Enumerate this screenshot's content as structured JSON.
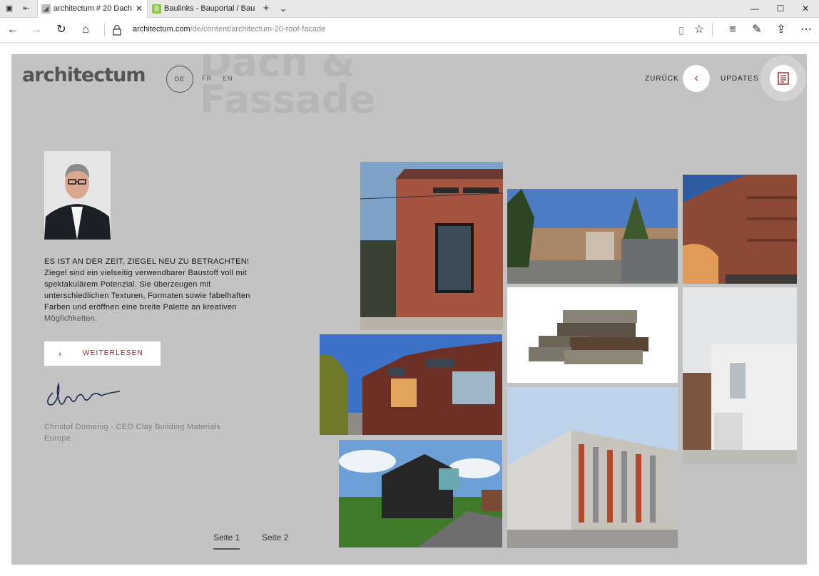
{
  "browser": {
    "tabs": [
      {
        "title": "architectum # 20 Dach",
        "active": true
      },
      {
        "title": "Baulinks - Bauportal / Baurr",
        "active": false
      }
    ],
    "url_host": "architectum.com",
    "url_path": "/de/content/architectum-20-roof-facade",
    "new_tab_label": "+",
    "tab_menu_label": "⌄"
  },
  "header": {
    "logo": "architectum",
    "ghost_title": "Dach &\nFassade",
    "languages": [
      "DE",
      "FR",
      "EN"
    ],
    "back_label": "ZURÜCK",
    "updates_label": "UPDATES"
  },
  "intro": {
    "text": "ES IST AN DER ZEIT, ZIEGEL NEU ZU BETRACHTEN! Ziegel sind ein vielseitig verwendbarer Baustoff voll mit spektakulärem Potenzial. Sie überzeugen mit unterschiedlichen Texturen, Formaten sowie fabelhaften Farben und eröffnen eine breite Palette an kreativen Möglichkeiten.",
    "read_more": "WEITERLESEN",
    "author": "Christof Domenig - CEO Clay Building Materials Europe"
  },
  "pager": [
    "Seite 1",
    "Seite 2"
  ],
  "colors": {
    "accent": "#9b1b1b",
    "page_bg": "#c3c3c3"
  }
}
